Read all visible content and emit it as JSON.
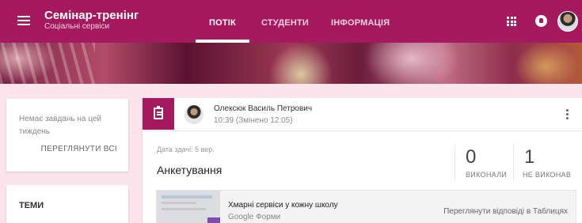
{
  "header": {
    "title": "Семінар-тренінг",
    "subtitle": "Соціальні сервіси",
    "tabs": [
      {
        "label": "ПОТІК"
      },
      {
        "label": "СТУДЕНТИ"
      },
      {
        "label": "ІНФОРМАЦІЯ"
      }
    ],
    "active_tab": "ПОТІК",
    "accent_color": "#a5195e"
  },
  "sidebar": {
    "upcoming_text": "Немає завдань на цей тиждень",
    "view_all_label": "ПЕРЕГЛЯНУТИ ВСІ",
    "topics_title": "ТЕМИ"
  },
  "post": {
    "author": "Олексюк Василь Петрович",
    "time": "10:39 (Змінено 12:05)",
    "due": "Дата здачі: 5 вер.",
    "title": "Анкетування",
    "stats": [
      {
        "value": "0",
        "label": "ВИКОНАЛИ"
      },
      {
        "value": "1",
        "label": "НЕ ВИКОНАВ"
      }
    ],
    "attachment": {
      "title": "Хмарні сервіси у кожну школу",
      "source": "Google Форми",
      "link_label": "Переглянути відповіді в Таблицях"
    }
  },
  "icons": [
    "menu-icon",
    "apps-icon",
    "notifications-icon",
    "assignment-icon",
    "more-vert-icon"
  ]
}
